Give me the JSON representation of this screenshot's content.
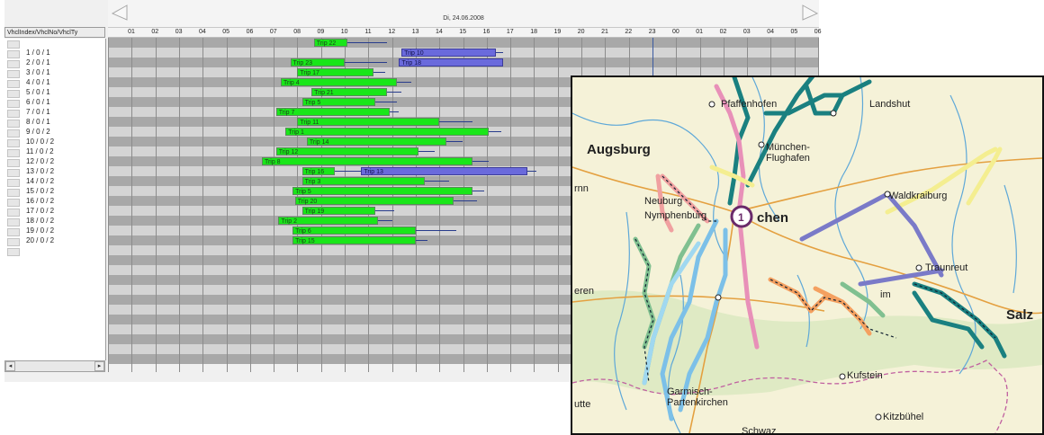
{
  "header": {
    "date": "Di, 24.06.2008",
    "hours": [
      "01",
      "02",
      "03",
      "04",
      "05",
      "06",
      "07",
      "08",
      "09",
      "10",
      "11",
      "12",
      "13",
      "14",
      "15",
      "16",
      "17",
      "18",
      "19",
      "20",
      "21",
      "22",
      "23",
      "00",
      "01",
      "02",
      "03",
      "04",
      "05",
      "06"
    ]
  },
  "left_panel": {
    "column_header": "VhclIndex/VhclNo/VhclTy",
    "rows": [
      "1 / 0 / 1",
      "2 / 0 / 1",
      "3 / 0 / 1",
      "4 / 0 / 1",
      "5 / 0 / 1",
      "6 / 0 / 1",
      "7 / 0 / 1",
      "8 / 0 / 1",
      "9 / 0 / 2",
      "10 / 0 / 2",
      "11 / 0 / 2",
      "12 / 0 / 2",
      "13 / 0 / 2",
      "14 / 0 / 2",
      "15 / 0 / 2",
      "16 / 0 / 2",
      "17 / 0 / 2",
      "18 / 0 / 2",
      "19 / 0 / 2",
      "20 / 0 / 2"
    ]
  },
  "scrollbar": {
    "left_arrow": "◂",
    "right_arrow": "▸"
  },
  "trips": [
    {
      "label": "Trip 22",
      "row": 0,
      "start": 9.2,
      "end": 10.6,
      "whisker": 12.3,
      "color": "green"
    },
    {
      "label": "Trip 10",
      "row": 1,
      "start": 12.9,
      "end": 16.9,
      "whisker": 17.2,
      "color": "blue"
    },
    {
      "label": "Trip 23",
      "row": 2,
      "start": 8.2,
      "end": 10.5,
      "whisker": 12.3,
      "color": "green"
    },
    {
      "label": "Trip 18",
      "row": 2,
      "start": 12.8,
      "end": 17.2,
      "whisker": null,
      "color": "blue"
    },
    {
      "label": "Trip 17",
      "row": 3,
      "start": 8.5,
      "end": 11.7,
      "whisker": 12.2,
      "color": "green"
    },
    {
      "label": "Trip 4",
      "row": 4,
      "start": 7.8,
      "end": 12.7,
      "whisker": 13.3,
      "color": "green"
    },
    {
      "label": "Trip 21",
      "row": 5,
      "start": 9.1,
      "end": 12.3,
      "whisker": 12.9,
      "color": "green"
    },
    {
      "label": "Trip 5",
      "row": 6,
      "start": 8.7,
      "end": 11.8,
      "whisker": 12.7,
      "color": "green"
    },
    {
      "label": "Trip 7",
      "row": 7,
      "start": 7.6,
      "end": 12.4,
      "whisker": 12.8,
      "color": "green"
    },
    {
      "label": "Trip 11",
      "row": 8,
      "start": 8.5,
      "end": 14.5,
      "whisker": 15.9,
      "color": "green"
    },
    {
      "label": "Trip 1",
      "row": 9,
      "start": 8.0,
      "end": 16.6,
      "whisker": 17.1,
      "color": "green"
    },
    {
      "label": "Trip 14",
      "row": 10,
      "start": 8.9,
      "end": 14.8,
      "whisker": 15.5,
      "color": "green"
    },
    {
      "label": "Trip 12",
      "row": 11,
      "start": 7.6,
      "end": 13.6,
      "whisker": 14.3,
      "color": "green"
    },
    {
      "label": "Trip 8",
      "row": 12,
      "start": 7.0,
      "end": 15.9,
      "whisker": 16.6,
      "color": "green"
    },
    {
      "label": "Trip 16",
      "row": 13,
      "start": 8.7,
      "end": 10.1,
      "whisker": 11.2,
      "color": "green"
    },
    {
      "label": "Trip 13",
      "row": 13,
      "start": 11.2,
      "end": 18.2,
      "whisker": 18.6,
      "color": "blue"
    },
    {
      "label": "Trip 3",
      "row": 14,
      "start": 8.7,
      "end": 13.9,
      "whisker": 14.9,
      "color": "green"
    },
    {
      "label": "Trip 5",
      "row": 15,
      "start": 8.3,
      "end": 15.9,
      "whisker": 16.4,
      "color": "green"
    },
    {
      "label": "Trip 20",
      "row": 16,
      "start": 8.4,
      "end": 15.1,
      "whisker": 16.1,
      "color": "green"
    },
    {
      "label": "Trip 19",
      "row": 17,
      "start": 8.7,
      "end": 11.8,
      "whisker": 12.6,
      "color": "green"
    },
    {
      "label": "Trip 2",
      "row": 18,
      "start": 7.7,
      "end": 11.9,
      "whisker": 12.5,
      "color": "green"
    },
    {
      "label": "Trip 6",
      "row": 19,
      "start": 8.3,
      "end": 13.5,
      "whisker": 15.2,
      "color": "green"
    },
    {
      "label": "Trip 15",
      "row": 20,
      "start": 8.3,
      "end": 13.5,
      "whisker": 14.0,
      "color": "green"
    }
  ],
  "map": {
    "labels": [
      "Landshut",
      "Pfaffenhofen",
      "Augsburg",
      "München-Flughafen",
      "Waldkraiburg",
      "Neuburg",
      "Nymphenburg",
      "chen",
      "Traunreut",
      "Salz",
      "eren",
      "Kufstein",
      "Garmisch-Partenkirchen",
      "Kitzbühel",
      "utte",
      "Schwaz",
      "rnn",
      "im"
    ],
    "route_colors": [
      "#1a8080",
      "#e890b8",
      "#f0a0a0",
      "#f4ee90",
      "#7a7ac8",
      "#f4a060",
      "#7cc0e8",
      "#80c090",
      "#a0d8f0"
    ]
  },
  "colors": {
    "trip_green": "#19e619",
    "trip_blue": "#6a6adc",
    "grid_dark": "#a8a8a8",
    "grid_light": "#d4d4d4"
  }
}
